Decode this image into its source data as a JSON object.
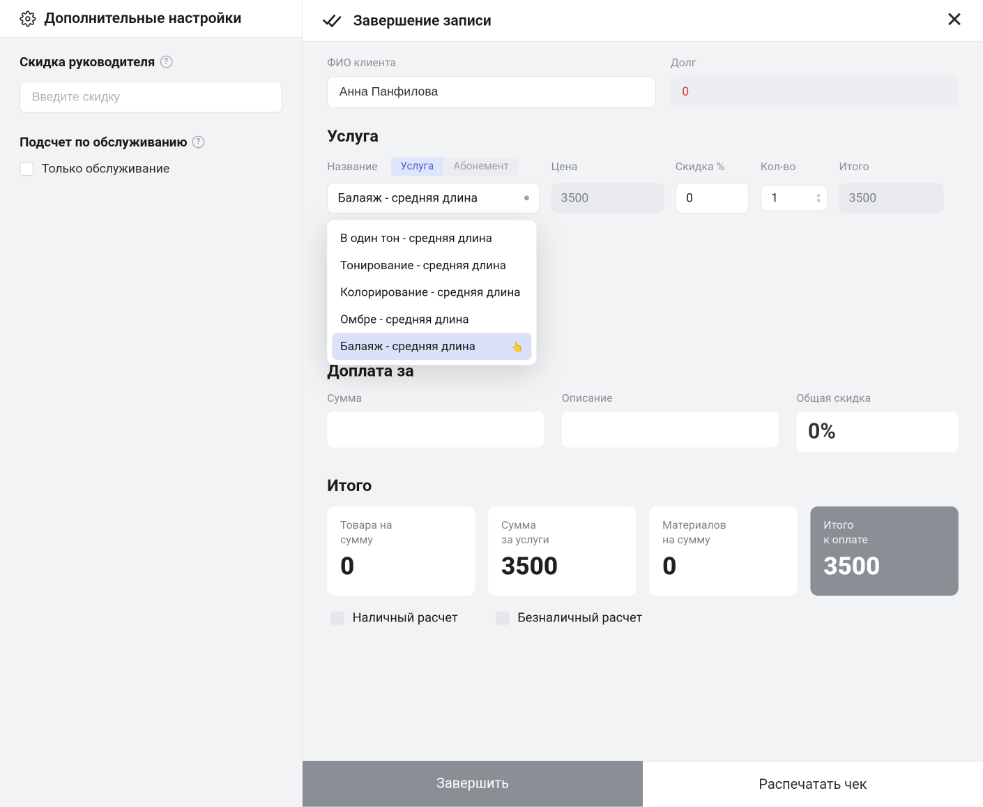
{
  "sidebar": {
    "title": "Дополнительные настройки",
    "discount_section": "Скидка руководителя",
    "discount_placeholder": "Введите скидку",
    "service_calc_section": "Подсчет по обслуживанию",
    "only_service_label": "Только обслуживание"
  },
  "header": {
    "title": "Завершение записи"
  },
  "client": {
    "name_label": "ФИО клиента",
    "name_value": "Анна Панфилова",
    "debt_label": "Долг",
    "debt_value": "0"
  },
  "service": {
    "section": "Услуга",
    "name_label": "Название",
    "tab_service": "Услуга",
    "tab_subscription": "Абонемент",
    "price_label": "Цена",
    "discount_label": "Скидка %",
    "qty_label": "Кол-во",
    "total_label": "Итого",
    "selected": "Балаяж - средняя длина",
    "price_value": "3500",
    "discount_value": "0",
    "qty_value": "1",
    "total_value": "3500",
    "dropdown": [
      "В один тон - средняя длина",
      "Тонирование - средняя длина",
      "Колорирование - средняя длина",
      "Омбре - средняя длина",
      "Балаяж - средняя длина"
    ]
  },
  "surcharge": {
    "section": "Доплата за",
    "amount_label": "Сумма",
    "desc_label": "Описание",
    "total_discount_label": "Общая скидка",
    "total_discount_value": "0%"
  },
  "totals": {
    "section": "Итого",
    "goods_label": "Товара на\nсумму",
    "goods_value": "0",
    "services_label": "Сумма\nза услуги",
    "services_value": "3500",
    "materials_label": "Материалов\nна сумму",
    "materials_value": "0",
    "due_label": "Итого\nк оплате",
    "due_value": "3500"
  },
  "payment": {
    "cash": "Наличный расчет",
    "noncash": "Безналичный расчет"
  },
  "footer": {
    "complete": "Завершить",
    "print": "Распечатать чек"
  }
}
